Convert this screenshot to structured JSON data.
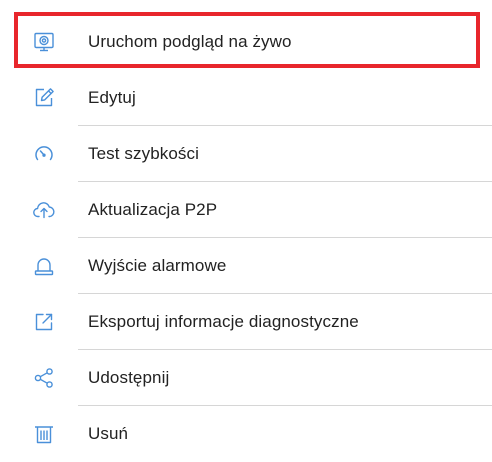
{
  "menu": {
    "items": [
      {
        "label": "Uruchom podgląd na żywo",
        "icon": "live-preview-monitor-icon"
      },
      {
        "label": "Edytuj",
        "icon": "edit-pencil-icon"
      },
      {
        "label": "Test szybkości",
        "icon": "speed-gauge-icon"
      },
      {
        "label": "Aktualizacja P2P",
        "icon": "cloud-upload-icon"
      },
      {
        "label": "Wyjście alarmowe",
        "icon": "alarm-siren-icon"
      },
      {
        "label": "Eksportuj informacje diagnostyczne",
        "icon": "export-icon"
      },
      {
        "label": "Udostępnij",
        "icon": "share-icon"
      },
      {
        "label": "Usuń",
        "icon": "trash-icon"
      }
    ]
  },
  "colors": {
    "icon": "#4a90d9",
    "highlight_border": "#e8262c",
    "text": "#222222",
    "divider": "#d6d6d6"
  }
}
